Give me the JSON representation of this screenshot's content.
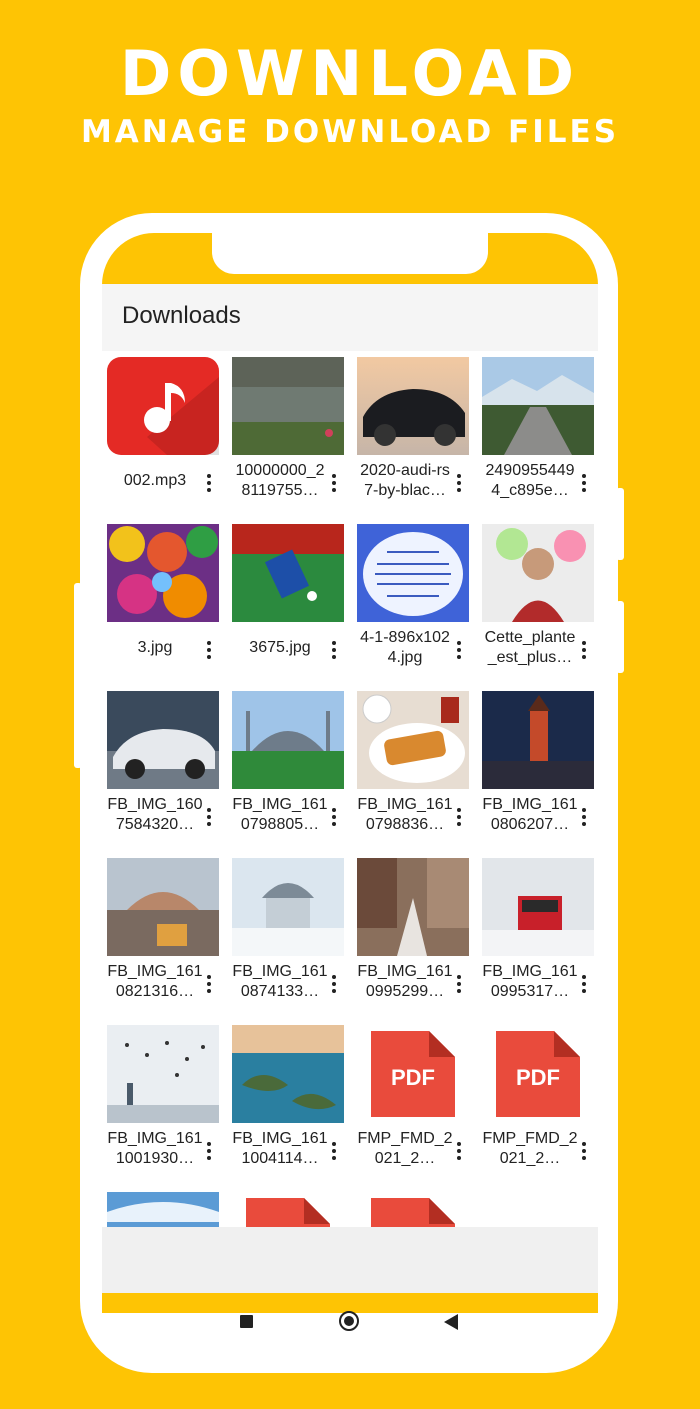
{
  "promo": {
    "title": "DOWNLOAD",
    "subtitle": "MANAGE DOWNLOAD FILES"
  },
  "app": {
    "title": "Downloads"
  },
  "files": [
    {
      "name": "002.mp3",
      "thumb": "music-icon"
    },
    {
      "name": "10000000_28119755…",
      "thumb": "lake-photo"
    },
    {
      "name": "2020-audi-rs7-by-blac…",
      "thumb": "car-photo"
    },
    {
      "name": "24909554494_c895e…",
      "thumb": "road-photo"
    },
    {
      "name": "3.jpg",
      "thumb": "leaves-photo"
    },
    {
      "name": "3675.jpg",
      "thumb": "football-photo"
    },
    {
      "name": "4-1-896x1024.jpg",
      "thumb": "arabic-text-image"
    },
    {
      "name": "Cette_plante_est_plus…",
      "thumb": "portrait-photo"
    },
    {
      "name": "FB_IMG_1607584320…",
      "thumb": "silver-car-photo"
    },
    {
      "name": "FB_IMG_1610798805…",
      "thumb": "mosque-photo"
    },
    {
      "name": "FB_IMG_1610798836…",
      "thumb": "pastry-photo"
    },
    {
      "name": "FB_IMG_1610806207…",
      "thumb": "tower-night-photo"
    },
    {
      "name": "FB_IMG_1610821316…",
      "thumb": "hagia-sophia-photo"
    },
    {
      "name": "FB_IMG_1610874133…",
      "thumb": "snow-fountain-photo"
    },
    {
      "name": "FB_IMG_1610995299…",
      "thumb": "snow-street-photo"
    },
    {
      "name": "FB_IMG_1610995317…",
      "thumb": "tram-snow-photo"
    },
    {
      "name": "FB_IMG_1611001930…",
      "thumb": "seagulls-photo"
    },
    {
      "name": "FB_IMG_1611004114…",
      "thumb": "islands-photo"
    },
    {
      "name": "FMP_FMD_2021_2…",
      "thumb": "pdf-icon",
      "badge": "PDF"
    },
    {
      "name": "FMP_FMD_2021_2…",
      "thumb": "pdf-icon",
      "badge": "PDF"
    },
    {
      "name": "",
      "thumb": "sky-photo"
    },
    {
      "name": "",
      "thumb": "pdf-icon"
    },
    {
      "name": "",
      "thumb": "pdf-icon"
    }
  ],
  "colors": {
    "background": "#FEC404",
    "pdf": "#E94B3C",
    "music": "#E42A25"
  }
}
